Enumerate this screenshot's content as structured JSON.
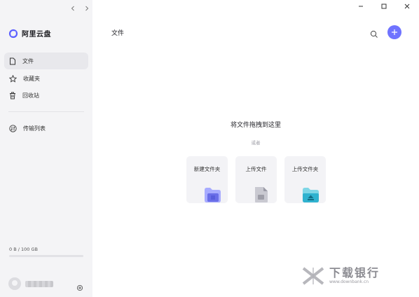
{
  "sidebar": {
    "app_name": "阿里云盘",
    "items": [
      {
        "label": "文件",
        "icon": "file-icon",
        "active": true
      },
      {
        "label": "收藏夹",
        "icon": "star-icon",
        "active": false
      },
      {
        "label": "回收站",
        "icon": "trash-icon",
        "active": false
      },
      {
        "label": "传输列表",
        "icon": "transfer-icon",
        "active": false
      }
    ],
    "storage": {
      "text": "0 B / 100 GB",
      "used_fraction": 0.0
    },
    "user": {
      "avatar": "avatar-icon",
      "username_blurred": true
    }
  },
  "main": {
    "title": "文件",
    "drop_hint": "将文件拖拽到这里",
    "or_text": "或者",
    "cards": [
      {
        "label": "新建文件夹",
        "icon": "new-folder-icon"
      },
      {
        "label": "上传文件",
        "icon": "upload-file-icon"
      },
      {
        "label": "上传文件夹",
        "icon": "upload-folder-icon"
      }
    ]
  },
  "watermark": {
    "title": "下载银行",
    "url": "www.downbank.cn"
  },
  "colors": {
    "accent": "#6f73ff",
    "sidebar_bg": "#f4f4f6",
    "card_bg": "#f3f3f6"
  }
}
